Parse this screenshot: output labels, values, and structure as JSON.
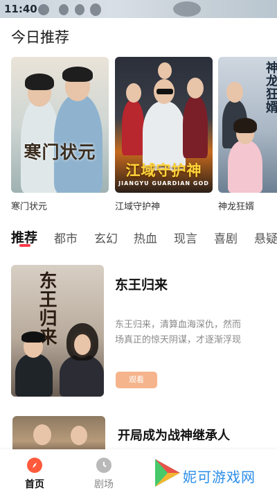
{
  "status": {
    "time": "11:40"
  },
  "recommend": {
    "title": "今日推荐",
    "posters": [
      {
        "caption": "寒门状元",
        "art": "寒门状元"
      },
      {
        "caption": "江域守护神",
        "art": "江域守护神",
        "art_en": "JIANGYU GUARDIAN GOD"
      },
      {
        "caption": "神龙狂婿",
        "art": "神龙狂婿"
      }
    ]
  },
  "tabs": [
    "推荐",
    "都市",
    "玄幻",
    "热血",
    "现言",
    "喜剧",
    "悬疑"
  ],
  "featured": {
    "name": "东王归来",
    "art": "东王归来",
    "desc_line1": "东王归来，清算血海深仇，然而",
    "desc_line2": "场真正的惊天阴谋，才逐渐浮现",
    "watch_label": "观看"
  },
  "featured2": {
    "name": "开局成为战神继承人"
  },
  "bottom_nav": {
    "home": "首页",
    "theater": "剧场"
  },
  "watermark": {
    "text": "妮可游戏网"
  },
  "colors": {
    "accent": "#ff3a4a",
    "watch_button": "#f5b48c",
    "nav_active": "#ff5a3c"
  }
}
